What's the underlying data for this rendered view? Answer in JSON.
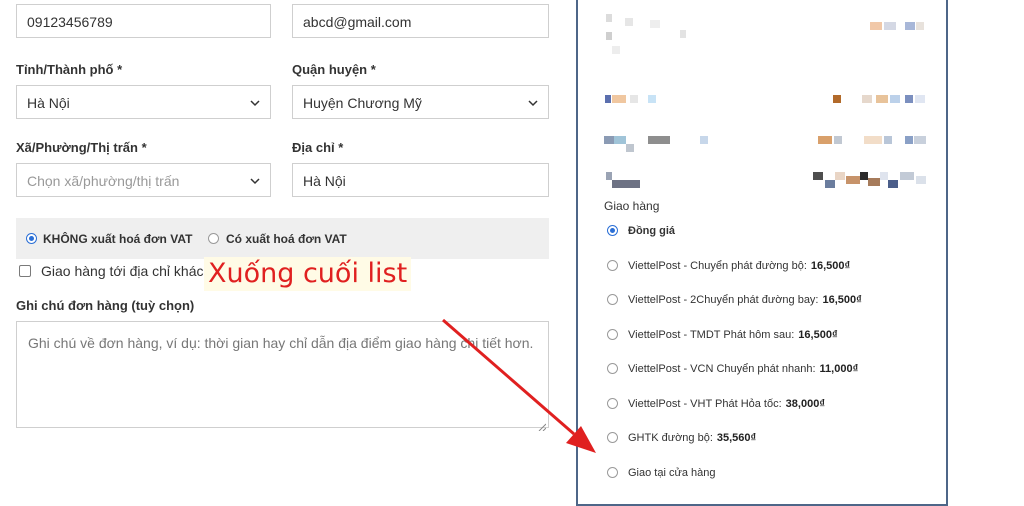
{
  "form": {
    "phone_value": "09123456789",
    "email_value": "abcd@gmail.com",
    "province_label": "Tỉnh/Thành phố",
    "province_value": "Hà Nội",
    "district_label": "Quận huyện",
    "district_value": "Huyện Chương Mỹ",
    "ward_label": "Xã/Phường/Thị trấn",
    "ward_placeholder": "Chọn xã/phường/thị trấn",
    "address_label": "Địa chỉ",
    "address_value": "Hà Nội",
    "required_mark": "*",
    "vat_no_label": "KHÔNG xuất hoá đơn VAT",
    "vat_yes_label": "Có xuất hoá đơn VAT",
    "ship_other_label": "Giao hàng tới địa chỉ khác?",
    "notes_label": "Ghi chú đơn hàng (tuỳ chọn)",
    "notes_placeholder": "Ghi chú về đơn hàng, ví dụ: thời gian hay chỉ dẫn địa điểm giao hàng chi tiết hơn."
  },
  "annotation": {
    "text": "Xuống cuối list",
    "color": "#e02020"
  },
  "shipping": {
    "heading": "Giao hàng",
    "options": [
      {
        "name": "Đồng giá",
        "price": "",
        "selected": true
      },
      {
        "name": "ViettelPost - Chuyển phát đường bộ:",
        "price": "16,500₫",
        "selected": false
      },
      {
        "name": "ViettelPost - 2Chuyển phát đường bay:",
        "price": "16,500₫",
        "selected": false
      },
      {
        "name": "ViettelPost - TMDT Phát hôm sau:",
        "price": "16,500₫",
        "selected": false
      },
      {
        "name": "ViettelPost - VCN Chuyển phát nhanh:",
        "price": "11,000₫",
        "selected": false
      },
      {
        "name": "ViettelPost - VHT Phát Hỏa tốc:",
        "price": "38,000₫",
        "selected": false
      },
      {
        "name": "GHTK đường bộ:",
        "price": "35,560₫",
        "selected": false
      },
      {
        "name": "Giao tại cửa hàng",
        "price": "",
        "selected": false
      }
    ]
  },
  "colors": {
    "accent": "#2b6fd6",
    "panel_border": "#4d6688",
    "arrow": "#e02020"
  }
}
